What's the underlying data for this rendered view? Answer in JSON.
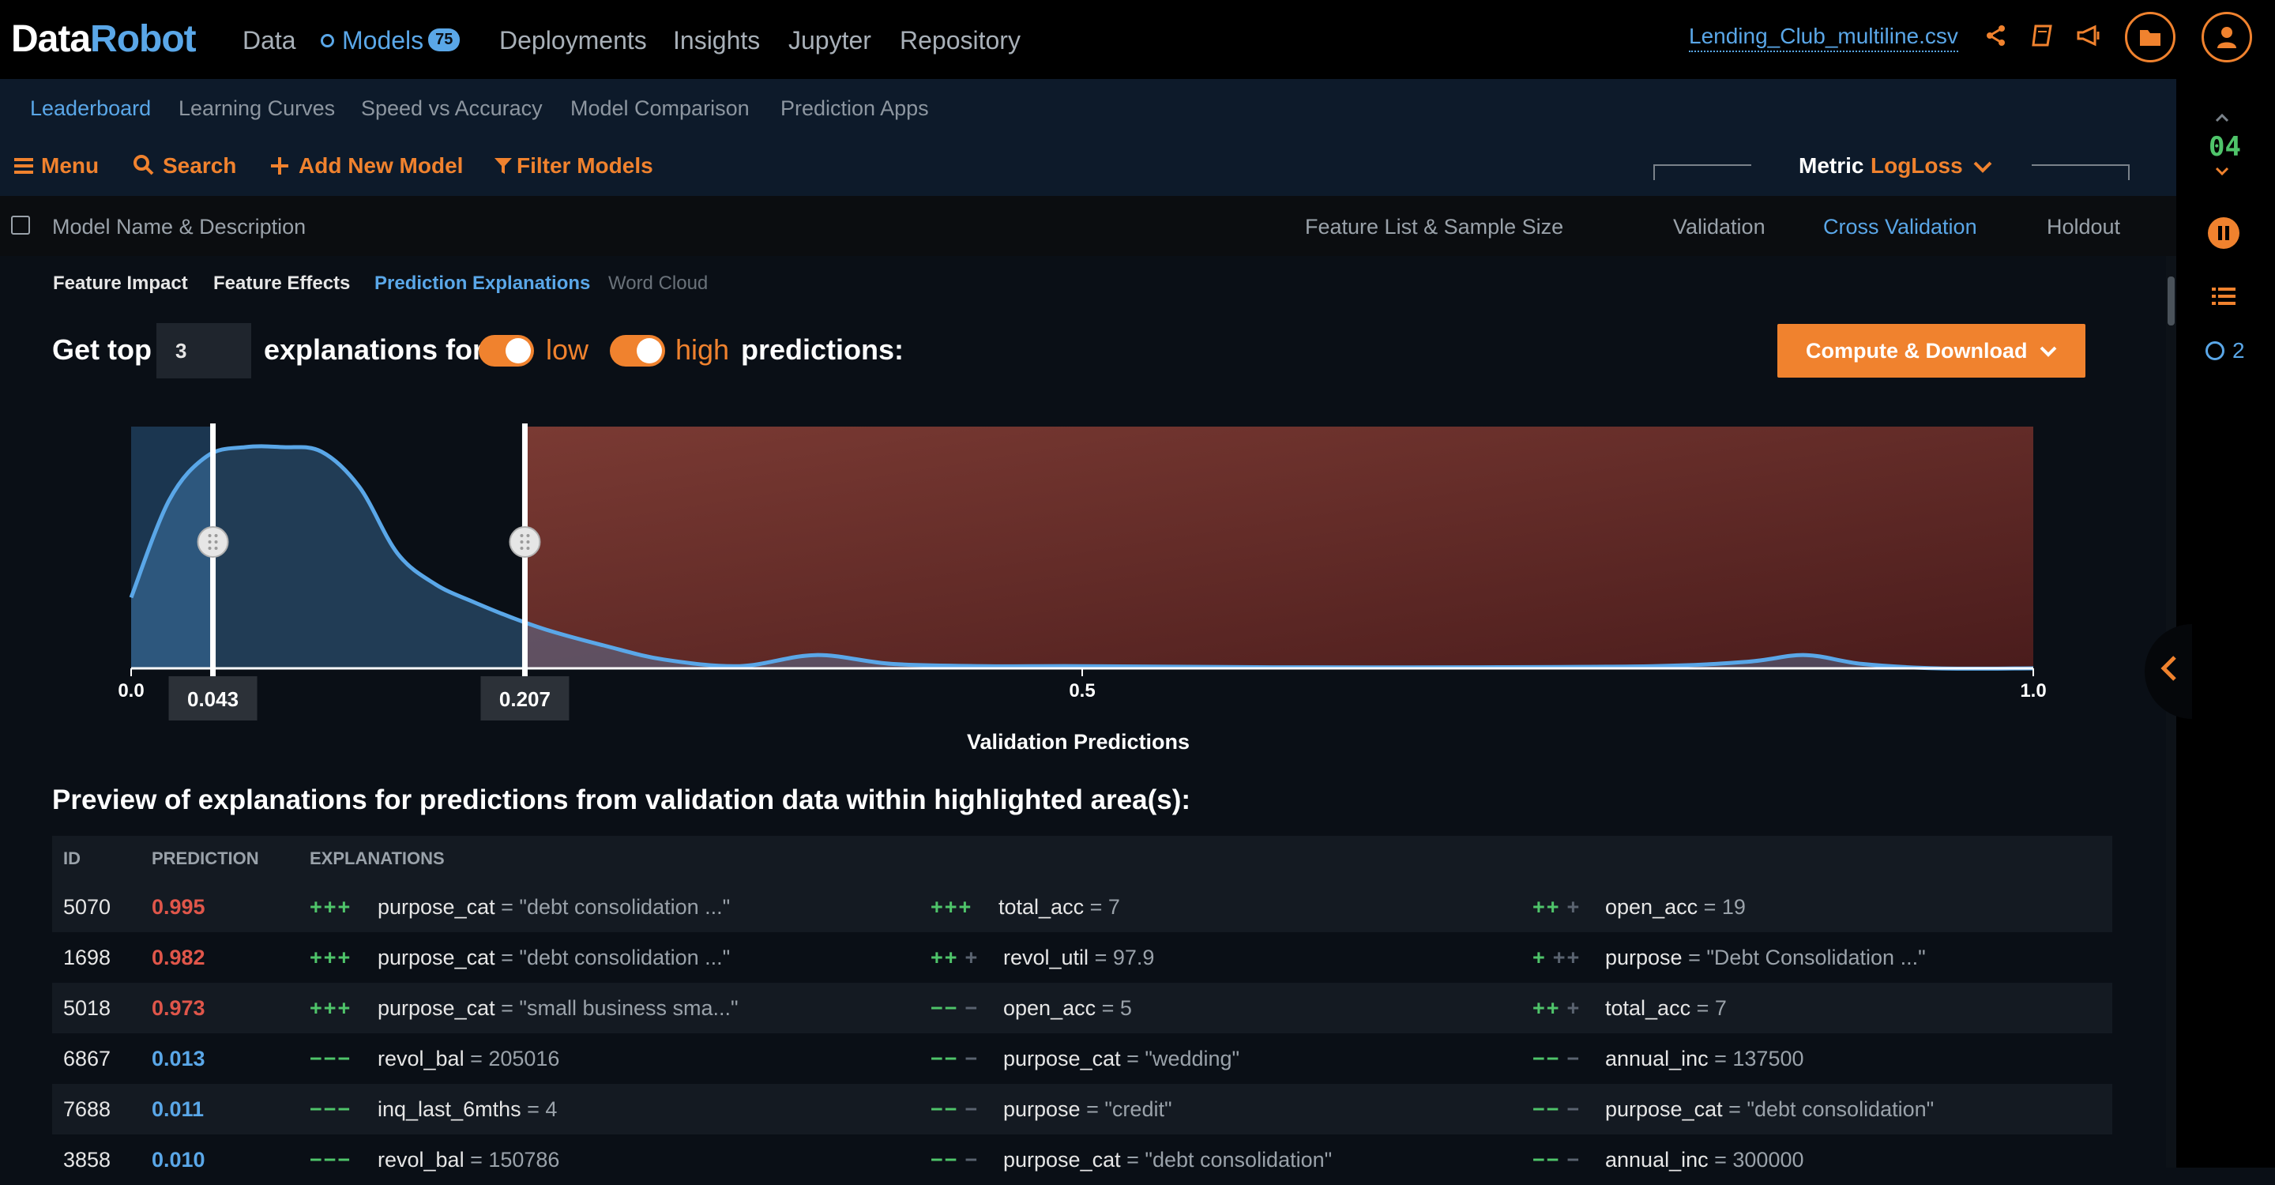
{
  "app": {
    "logo_part1": "Data",
    "logo_part2": "Robot"
  },
  "nav": {
    "items": [
      "Data",
      "Models",
      "Deployments",
      "Insights",
      "Jupyter",
      "Repository"
    ],
    "models_badge": "75",
    "dataset": "Lending_Club_multiline.csv"
  },
  "subnav": [
    "Leaderboard",
    "Learning Curves",
    "Speed vs Accuracy",
    "Model Comparison",
    "Prediction Apps"
  ],
  "toolbar": {
    "menu": "Menu",
    "search": "Search",
    "add_model": "Add New Model",
    "filter": "Filter Models",
    "metric_label": "Metric",
    "metric_value": "LogLoss"
  },
  "columns": {
    "model": "Model Name & Description",
    "features": "Feature List & Sample Size",
    "validation": "Validation",
    "cross_validation": "Cross Validation",
    "holdout": "Holdout"
  },
  "insight_tabs": [
    "Feature Impact",
    "Feature Effects",
    "Prediction Explanations",
    "Word Cloud"
  ],
  "controls": {
    "get_top": "Get top",
    "top_n": "3",
    "explanations_for": "explanations for",
    "low": "low",
    "high": "high",
    "predictions": "predictions:",
    "compute_label": "Compute & Download"
  },
  "chart_data": {
    "type": "area",
    "xlabel": "Validation Predictions",
    "xlim": [
      0.0,
      1.0
    ],
    "x_ticks": [
      "0.0",
      "0.5",
      "1.0"
    ],
    "low_threshold": 0.043,
    "high_threshold": 0.207,
    "low_threshold_label": "0.043",
    "high_threshold_label": "0.207",
    "density_curve": {
      "x": [
        0.0,
        0.02,
        0.04,
        0.06,
        0.08,
        0.1,
        0.12,
        0.14,
        0.16,
        0.18,
        0.2,
        0.22,
        0.25,
        0.28,
        0.32,
        0.36,
        0.4,
        0.45,
        0.5,
        0.6,
        0.7,
        0.8,
        0.85,
        0.88,
        0.91,
        0.95,
        1.0
      ],
      "y": [
        0.32,
        0.76,
        0.96,
        1.0,
        1.0,
        0.98,
        0.82,
        0.52,
        0.38,
        0.3,
        0.23,
        0.17,
        0.1,
        0.04,
        0.01,
        0.06,
        0.02,
        0.01,
        0.01,
        0.005,
        0.005,
        0.01,
        0.03,
        0.06,
        0.02,
        0.0,
        0.0
      ]
    },
    "colors": {
      "low": "#5aa7e8",
      "high": "#e0564a",
      "accent": "#f0822e"
    }
  },
  "preview": {
    "title": "Preview of explanations for predictions from validation data within highlighted area(s):",
    "headers": [
      "ID",
      "PREDICTION",
      "EXPLANATIONS"
    ],
    "rows": [
      {
        "id": "5070",
        "pred": "0.995",
        "level": "high",
        "ex": [
          {
            "s": "+++",
            "d": "",
            "f": "purpose_cat",
            "v": " = \"debt consolidation ...\""
          },
          {
            "s": "+++",
            "d": "",
            "f": "total_acc",
            "v": " = 7"
          },
          {
            "s": "++",
            "d": "+",
            "f": "open_acc",
            "v": " = 19"
          }
        ]
      },
      {
        "id": "1698",
        "pred": "0.982",
        "level": "high",
        "ex": [
          {
            "s": "+++",
            "d": "",
            "f": "purpose_cat",
            "v": " = \"debt consolidation ...\""
          },
          {
            "s": "++",
            "d": "+",
            "f": "revol_util",
            "v": " = 97.9"
          },
          {
            "s": "+",
            "d": "++",
            "f": "purpose",
            "v": " = \"Debt Consolidation ...\""
          }
        ]
      },
      {
        "id": "5018",
        "pred": "0.973",
        "level": "high",
        "ex": [
          {
            "s": "+++",
            "d": "",
            "f": "purpose_cat",
            "v": " = \"small business sma...\""
          },
          {
            "s": "−−",
            "d": "−",
            "f": "open_acc",
            "v": " = 5"
          },
          {
            "s": "++",
            "d": "+",
            "f": "total_acc",
            "v": " = 7"
          }
        ]
      },
      {
        "id": "6867",
        "pred": "0.013",
        "level": "low",
        "ex": [
          {
            "s": "−−−",
            "d": "",
            "f": "revol_bal",
            "v": " = 205016"
          },
          {
            "s": "−−",
            "d": "−",
            "f": "purpose_cat",
            "v": " = \"wedding\""
          },
          {
            "s": "−−",
            "d": "−",
            "f": "annual_inc",
            "v": " = 137500"
          }
        ]
      },
      {
        "id": "7688",
        "pred": "0.011",
        "level": "low",
        "ex": [
          {
            "s": "−−−",
            "d": "",
            "f": "inq_last_6mths",
            "v": " = 4"
          },
          {
            "s": "−−",
            "d": "−",
            "f": "purpose",
            "v": " = \"credit\""
          },
          {
            "s": "−−",
            "d": "−",
            "f": "purpose_cat",
            "v": " = \"debt consolidation\""
          }
        ]
      },
      {
        "id": "3858",
        "pred": "0.010",
        "level": "low",
        "ex": [
          {
            "s": "−−−",
            "d": "",
            "f": "revol_bal",
            "v": " = 150786"
          },
          {
            "s": "−−",
            "d": "−",
            "f": "purpose_cat",
            "v": " = \"debt consolidation\""
          },
          {
            "s": "−−",
            "d": "−",
            "f": "annual_inc",
            "v": " = 300000"
          }
        ]
      }
    ]
  },
  "rail": {
    "counter": "04",
    "queue_count": "2"
  },
  "icons": [
    "share-icon",
    "book-icon",
    "megaphone-icon",
    "folder-icon",
    "user-icon",
    "menu-icon",
    "search-icon",
    "plus-icon",
    "filter-icon",
    "chevron-down-icon",
    "pause-icon",
    "list-icon",
    "chevron-left-icon"
  ]
}
